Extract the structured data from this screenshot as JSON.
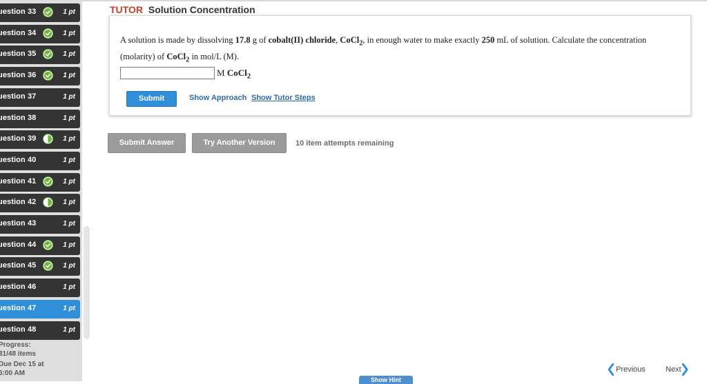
{
  "sidebar": {
    "questions": [
      {
        "label": "uestion 33",
        "status": "check",
        "points": "1 pt",
        "active": false
      },
      {
        "label": "uestion 34",
        "status": "check",
        "points": "1 pt",
        "active": false
      },
      {
        "label": "uestion 35",
        "status": "check",
        "points": "1 pt",
        "active": false
      },
      {
        "label": "uestion 36",
        "status": "check",
        "points": "1 pt",
        "active": false
      },
      {
        "label": "uestion 37",
        "status": "none",
        "points": "1 pt",
        "active": false
      },
      {
        "label": "uestion 38",
        "status": "none",
        "points": "1 pt",
        "active": false
      },
      {
        "label": "uestion 39",
        "status": "partial",
        "points": "1 pt",
        "active": false
      },
      {
        "label": "uestion 40",
        "status": "none",
        "points": "1 pt",
        "active": false
      },
      {
        "label": "uestion 41",
        "status": "check",
        "points": "1 pt",
        "active": false
      },
      {
        "label": "uestion 42",
        "status": "partial",
        "points": "1 pt",
        "active": false
      },
      {
        "label": "uestion 43",
        "status": "none",
        "points": "1 pt",
        "active": false
      },
      {
        "label": "uestion 44",
        "status": "check",
        "points": "1 pt",
        "active": false
      },
      {
        "label": "uestion 45",
        "status": "check",
        "points": "1 pt",
        "active": false
      },
      {
        "label": "uestion 46",
        "status": "none",
        "points": "1 pt",
        "active": false
      },
      {
        "label": "uestion 47",
        "status": "none",
        "points": "1 pt",
        "active": true
      },
      {
        "label": "uestion 48",
        "status": "none",
        "points": "1 pt",
        "active": false
      }
    ],
    "progress_label": "Progress:",
    "progress_value": "31/48 items",
    "due_line1": "Due Dec 15 at",
    "due_line2": "6:00 AM"
  },
  "header": {
    "tag": "TUTOR",
    "title": "Solution Concentration"
  },
  "problem": {
    "text_1": "A solution is made by dissolving ",
    "mass": "17.8",
    "text_2": " g of ",
    "compound": "cobalt(II) chloride",
    "text_3": ", ",
    "formula_base": "CoCl",
    "formula_sub": "2",
    "text_4": ", in enough water to make exactly ",
    "volume": "250",
    "text_5": " mL of solution. Calculate the concentration (molarity) of ",
    "formula2_base": "CoCl",
    "formula2_sub": "2",
    "text_6": " in mol/L (M)."
  },
  "answer": {
    "value": "",
    "unit_prefix": "M ",
    "unit_base": "CoCl",
    "unit_sub": "2"
  },
  "actions": {
    "submit": "Submit",
    "show_approach": "Show Approach",
    "show_tutor_steps": "Show Tutor Steps",
    "submit_answer": "Submit Answer",
    "try_another": "Try Another Version",
    "attempts": "10 item attempts remaining"
  },
  "navigation": {
    "previous": "Previous",
    "next": "Next",
    "hint_tab": "Show Hint"
  },
  "colors": {
    "accent_blue": "#2f8fd8",
    "sidebar_dark": "#343434",
    "check_green": "#6fb43f",
    "tutor_red": "#c0452b"
  }
}
